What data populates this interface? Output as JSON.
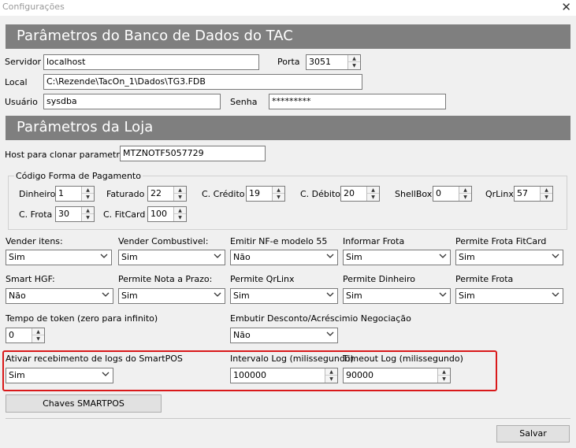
{
  "window": {
    "title": "Configurações",
    "close": "✕"
  },
  "db": {
    "header": "Parâmetros do Banco de Dados do TAC",
    "servidor_label": "Servidor",
    "servidor_value": "localhost",
    "porta_label": "Porta",
    "porta_value": "3051",
    "local_label": "Local",
    "local_value": "C:\\Rezende\\TacOn_1\\Dados\\TG3.FDB",
    "usuario_label": "Usuário",
    "usuario_value": "sysdba",
    "senha_label": "Senha",
    "senha_value": "*********"
  },
  "loja": {
    "header": "Parâmetros da Loja",
    "host_label": "Host para clonar parametros:",
    "host_value": "MTZNOTF5057729",
    "pagamento_group": "Código Forma de Pagamento",
    "dinheiro_label": "Dinheiro",
    "dinheiro_value": "1",
    "faturado_label": "Faturado",
    "faturado_value": "22",
    "ccredito_label": "C. Crédito",
    "ccredito_value": "19",
    "cdebito_label": "C. Débito",
    "cdebito_value": "20",
    "shellbox_label": "ShellBox",
    "shellbox_value": "0",
    "qrlinx_label": "QrLinx",
    "qrlinx_value": "57",
    "cfrota_label": "C. Frota",
    "cfrota_value": "30",
    "cfitcard_label": "C. FitCard",
    "cfitcard_value": "100"
  },
  "options": {
    "vender_itens_label": "Vender itens:",
    "vender_itens_value": "Sim",
    "vender_comb_label": "Vender Combustivel:",
    "vender_comb_value": "Sim",
    "emitir_nfe_label": "Emitir NF-e modelo 55",
    "emitir_nfe_value": "Não",
    "informar_frota_label": "Informar Frota",
    "informar_frota_value": "Sim",
    "frota_fitcard_label": "Permite Frota FitCard",
    "frota_fitcard_value": "Sim",
    "smart_hgf_label": "Smart HGF:",
    "smart_hgf_value": "Não",
    "nota_prazo_label": "Permite Nota a Prazo:",
    "nota_prazo_value": "Sim",
    "permite_qrlinx_label": "Permite QrLinx",
    "permite_qrlinx_value": "Sim",
    "permite_dinheiro_label": "Permite Dinheiro",
    "permite_dinheiro_value": "Sim",
    "permite_frota_label": "Permite Frota",
    "permite_frota_value": "Sim",
    "token_label": "Tempo de token (zero para infinito)",
    "token_value": "0",
    "embutir_label": "Embutir Desconto/Acréscimio Negociação",
    "embutir_value": "Não",
    "logs_label": "Ativar recebimento de logs do SmartPOS",
    "logs_value": "Sim",
    "intervalo_label": "Intervalo Log (milissegundo)",
    "intervalo_value": "100000",
    "timeout_label": "Timeout Log (milissegundo)",
    "timeout_value": "90000"
  },
  "buttons": {
    "chaves": "Chaves SMARTPOS",
    "salvar": "Salvar"
  },
  "colors": {
    "header_bg": "#7f7f7f",
    "highlight": "#d9191a"
  }
}
